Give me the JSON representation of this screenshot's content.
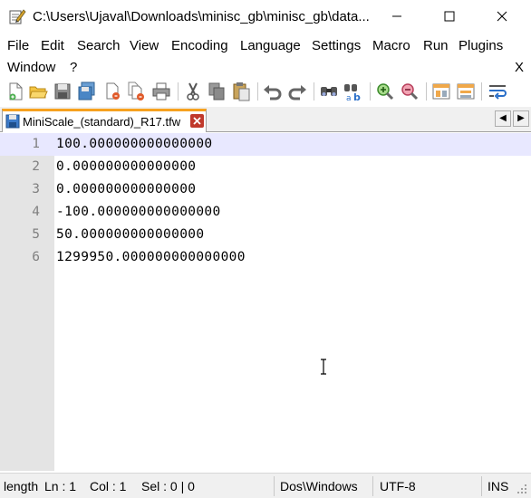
{
  "window": {
    "title": "C:\\Users\\Ujaval\\Downloads\\minisc_gb\\minisc_gb\\data...",
    "minimize_glyph": "─",
    "maximize_glyph": "☐",
    "close_glyph": "✕"
  },
  "menu": {
    "items": [
      "File",
      "Edit",
      "Search",
      "View",
      "Encoding",
      "Language",
      "Settings",
      "Macro",
      "Run",
      "Plugins",
      "Window",
      "?"
    ],
    "close_x": "X"
  },
  "toolbar": {
    "icons": [
      "new-file-icon",
      "open-file-icon",
      "save-icon",
      "save-all-icon",
      "close-icon",
      "close-all-icon",
      "print-icon",
      "cut-icon",
      "copy-icon",
      "paste-icon",
      "undo-icon",
      "redo-icon",
      "find-icon",
      "replace-icon",
      "zoom-in-icon",
      "zoom-out-icon",
      "sync-vertical-icon",
      "sync-horizontal-icon",
      "word-wrap-icon"
    ]
  },
  "tab": {
    "label": "MiniScale_(standard)_R17.tfw",
    "scroll_left": "◀",
    "scroll_right": "▶"
  },
  "editor": {
    "lines": [
      {
        "num": "1",
        "text": "100.000000000000000"
      },
      {
        "num": "2",
        "text": "0.000000000000000"
      },
      {
        "num": "3",
        "text": "0.000000000000000"
      },
      {
        "num": "4",
        "text": "-100.000000000000000"
      },
      {
        "num": "5",
        "text": "50.000000000000000"
      },
      {
        "num": "6",
        "text": "1299950.000000000000000"
      }
    ]
  },
  "status": {
    "length": "length",
    "ln": "Ln : 1",
    "col": "Col : 1",
    "sel": "Sel : 0 | 0",
    "eol": "Dos\\Windows",
    "encoding": "UTF-8",
    "mode": "INS"
  },
  "colors": {
    "current_line": "#e8e8ff",
    "gutter": "#e4e4e4",
    "tab_accent": "#f7a11f"
  }
}
